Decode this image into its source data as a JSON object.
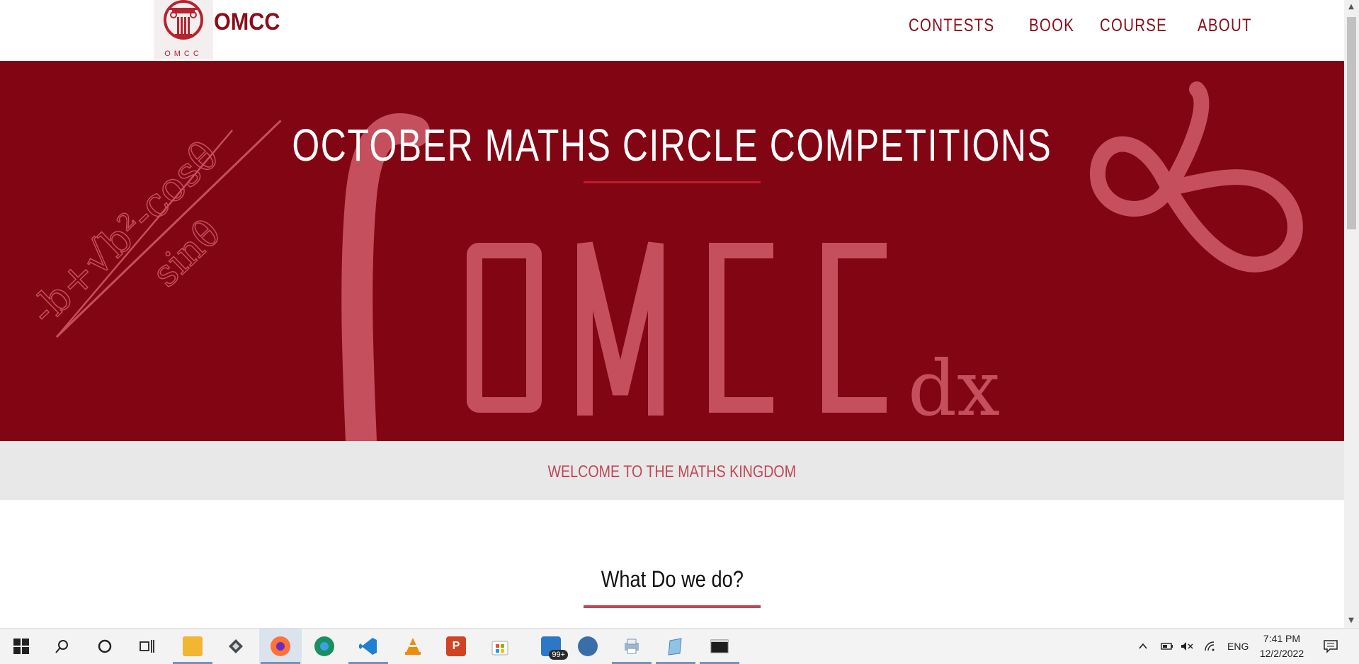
{
  "site": {
    "brand": "OMCC",
    "logo_caption": "OMCC",
    "nav": [
      "CONTESTS",
      "BOOK",
      "COURSE",
      "ABOUT"
    ]
  },
  "hero": {
    "title": "OCTOBER MATHS CIRCLE COMPETITIONS",
    "watermark_text": "OMCC",
    "watermark_suffix": "dx",
    "formula_top": "-b+√b²-cosθ",
    "formula_bottom": "sinθ"
  },
  "welcome": {
    "text": "WELCOME TO THE MATHS KINGDOM"
  },
  "section": {
    "title": "What Do we do?"
  },
  "taskbar": {
    "apps": [
      "start-icon",
      "search-icon",
      "cortana-icon",
      "task-view-icon",
      "file-explorer-icon",
      "app-icon",
      "firefox-icon",
      "edge-icon",
      "vscode-icon",
      "vlc-icon",
      "powerpoint-icon",
      "store-icon",
      "mail-icon",
      "globe-icon",
      "printer-icon",
      "notepad-icon",
      "terminal-icon"
    ],
    "mail_badge": "99+",
    "language": "ENG",
    "time": "7:41 PM",
    "date": "12/2/2022"
  },
  "colors": {
    "brand_dark": "#820514",
    "accent": "#c24656",
    "deco": "#c54f5d"
  }
}
